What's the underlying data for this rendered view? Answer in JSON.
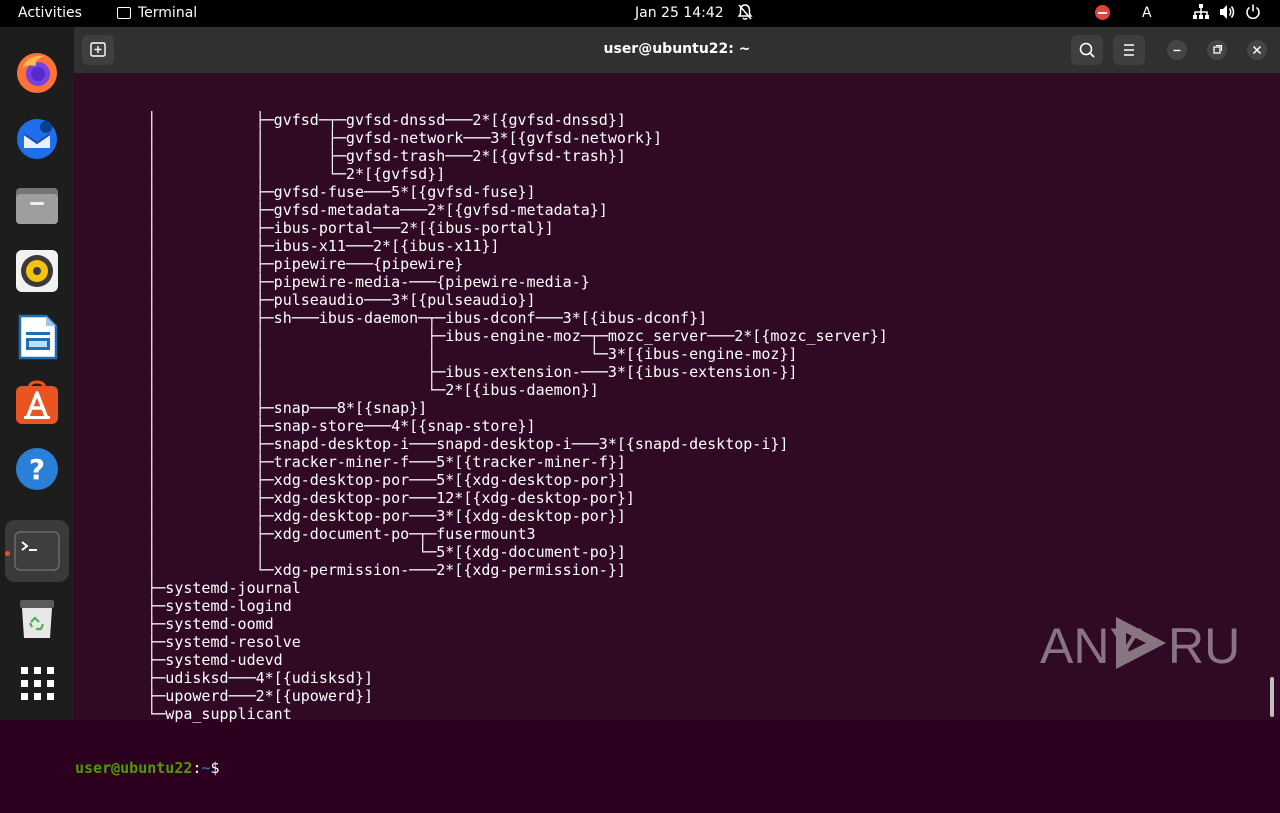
{
  "topbar": {
    "activities": "Activities",
    "app_name": "Terminal",
    "clock": "Jan 25  14:42",
    "language": "A"
  },
  "dock": {
    "apps": [
      "firefox-icon",
      "thunderbird-icon",
      "files-icon",
      "rhythmbox-icon",
      "writer-icon",
      "app-center-icon",
      "help-icon",
      "terminal-icon",
      "trash-icon",
      "show-apps-icon"
    ],
    "accent": "#e95420"
  },
  "window": {
    "title": "user@ubuntu22: ~",
    "lines": [
      "        │           ├─gvfsd─┬─gvfsd-dnssd───2*[{gvfsd-dnssd}]",
      "        │           │       ├─gvfsd-network───3*[{gvfsd-network}]",
      "        │           │       ├─gvfsd-trash───2*[{gvfsd-trash}]",
      "        │           │       └─2*[{gvfsd}]",
      "        │           ├─gvfsd-fuse───5*[{gvfsd-fuse}]",
      "        │           ├─gvfsd-metadata───2*[{gvfsd-metadata}]",
      "        │           ├─ibus-portal───2*[{ibus-portal}]",
      "        │           ├─ibus-x11───2*[{ibus-x11}]",
      "        │           ├─pipewire───{pipewire}",
      "        │           ├─pipewire-media-───{pipewire-media-}",
      "        │           ├─pulseaudio───3*[{pulseaudio}]",
      "        │           ├─sh───ibus-daemon─┬─ibus-dconf───3*[{ibus-dconf}]",
      "        │           │                  ├─ibus-engine-moz─┬─mozc_server───2*[{mozc_server}]",
      "        │           │                  │                 └─3*[{ibus-engine-moz}]",
      "        │           │                  ├─ibus-extension-───3*[{ibus-extension-}]",
      "        │           │                  └─2*[{ibus-daemon}]",
      "        │           ├─snap───8*[{snap}]",
      "        │           ├─snap-store───4*[{snap-store}]",
      "        │           ├─snapd-desktop-i───snapd-desktop-i───3*[{snapd-desktop-i}]",
      "        │           ├─tracker-miner-f───5*[{tracker-miner-f}]",
      "        │           ├─xdg-desktop-por───5*[{xdg-desktop-por}]",
      "        │           ├─xdg-desktop-por───12*[{xdg-desktop-por}]",
      "        │           ├─xdg-desktop-por───3*[{xdg-desktop-por}]",
      "        │           ├─xdg-document-po─┬─fusermount3",
      "        │           │                 └─5*[{xdg-document-po}]",
      "        │           └─xdg-permission-───2*[{xdg-permission-}]",
      "        ├─systemd-journal",
      "        ├─systemd-logind",
      "        ├─systemd-oomd",
      "        ├─systemd-resolve",
      "        ├─systemd-udevd",
      "        ├─udisksd───4*[{udisksd}]",
      "        ├─upowerd───2*[{upowerd}]",
      "        └─wpa_supplicant"
    ],
    "prompt_user": "user@ubuntu22",
    "prompt_sep": ":",
    "prompt_path": "~",
    "prompt_symbol": "$ "
  },
  "watermark": {
    "text": "ANY RUN"
  }
}
